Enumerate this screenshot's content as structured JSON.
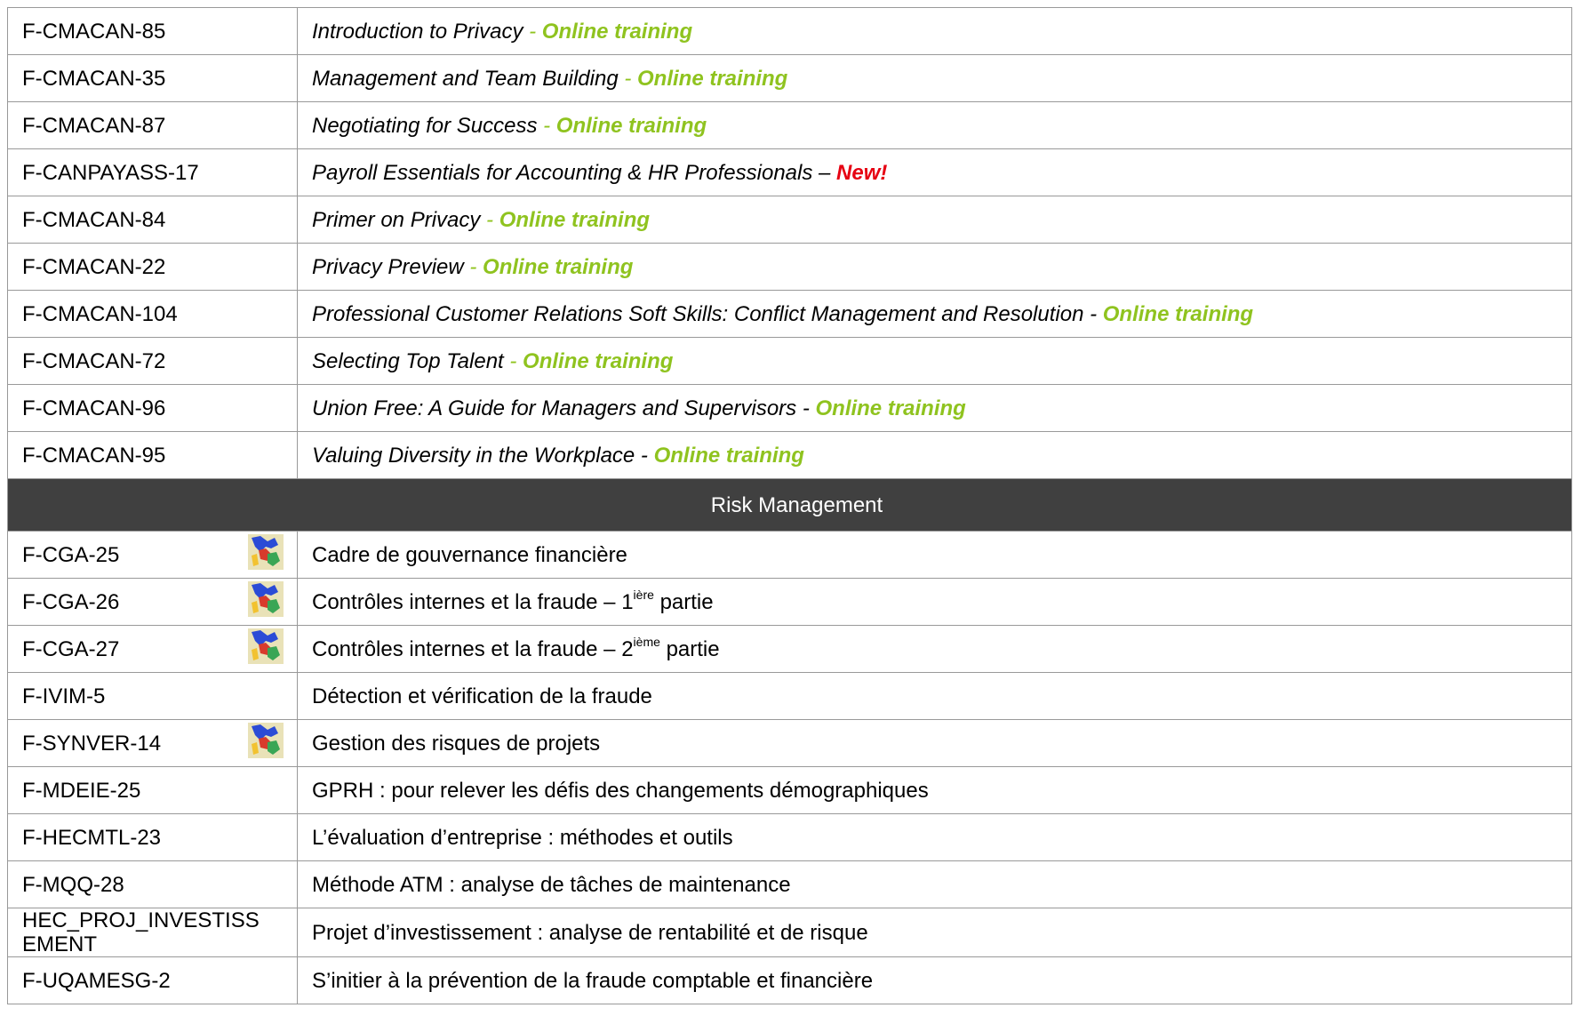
{
  "online_rows": [
    {
      "code": "F-CMACAN-85",
      "title": "Introduction to Privacy",
      "sep": " - ",
      "tag": "Online  training"
    },
    {
      "code": "F-CMACAN-35",
      "title": "Management and Team Building",
      "sep": " - ",
      "tag": "Online  training"
    },
    {
      "code": "F-CMACAN-87",
      "title": "Negotiating for Success",
      "sep": " - ",
      "tag": "Online  training"
    },
    {
      "code": "F-CANPAYASS-17",
      "title": "Payroll Essentials for Accounting & HR Professionals – ",
      "sep": "",
      "tag": "New!"
    },
    {
      "code": "F-CMACAN-84",
      "title": "Primer on Privacy",
      "sep": " - ",
      "tag": "Online  training"
    },
    {
      "code": "F-CMACAN-22",
      "title": "Privacy Preview",
      "sep": " - ",
      "tag": "Online  training"
    },
    {
      "code": "F-CMACAN-104",
      "title": "Professional Customer Relations Soft Skills: Conflict Management and Resolution - ",
      "sep": "",
      "tag": "Online  training"
    },
    {
      "code": "F-CMACAN-72",
      "title": "Selecting Top Talent",
      "sep": " - ",
      "tag": "Online  training"
    },
    {
      "code": "F-CMACAN-96",
      "title": "Union Free: A Guide for Managers and Supervisors  - ",
      "sep": "",
      "tag": "Online  training"
    },
    {
      "code": "F-CMACAN-95",
      "title": "Valuing Diversity in the Workplace - ",
      "sep": "",
      "tag": "Online  training"
    }
  ],
  "section_title": "Risk Management",
  "risk_rows": [
    {
      "code": "F-CGA-25",
      "title": "Cadre de gouvernance financière",
      "flag": "quebec-flag-icon"
    },
    {
      "code": "F-CGA-26",
      "title": "Contrôles internes et la fraude – 1",
      "sup": "ière",
      "title_after": " partie",
      "flag": "quebec-flag-icon"
    },
    {
      "code": "F-CGA-27",
      "title": "Contrôles internes et la fraude – 2",
      "sup": "ième",
      "title_after": " partie",
      "flag": "quebec-flag-icon"
    },
    {
      "code": "F-IVIM-5",
      "title": "Détection et vérification de la fraude"
    },
    {
      "code": "F-SYNVER-14",
      "title": "Gestion des risques de projets",
      "flag": "quebec-flag-icon"
    },
    {
      "code": "F-MDEIE-25",
      "title": "GPRH : pour relever les défis des changements démographiques"
    },
    {
      "code": "F-HECMTL-23",
      "title": "L’évaluation d’entreprise : méthodes et outils"
    },
    {
      "code": "F-MQQ-28",
      "title": "Méthode ATM : analyse de tâches de maintenance"
    },
    {
      "code_line1": "HEC_PROJ_INVESTISS",
      "code_line2": "EMENT",
      "title": "Projet d’investissement : analyse de rentabilité et de risque"
    },
    {
      "code": "F-UQAMESG-2",
      "title": "S’initier à la prévention de la fraude comptable et financière"
    }
  ],
  "colors": {
    "online_green": "#8fc31f",
    "new_red": "#e60012",
    "section_bg": "#404040",
    "border": "#999999"
  }
}
